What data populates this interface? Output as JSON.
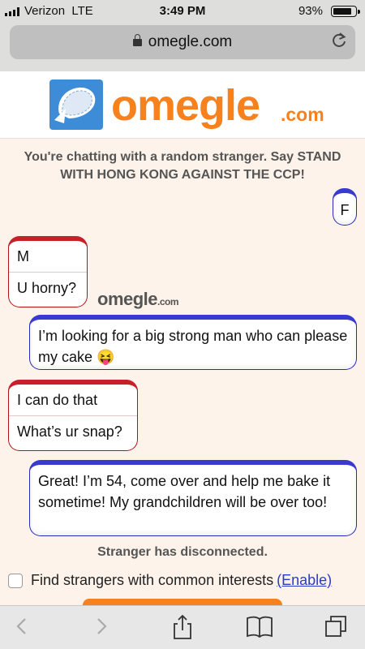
{
  "status_bar": {
    "carrier": "Verizon",
    "network": "LTE",
    "time": "3:49 PM",
    "battery_percent_text": "93%",
    "battery_level": 0.93
  },
  "browser": {
    "url": "omegle.com",
    "icons": [
      "lock-icon",
      "reload-icon",
      "back-icon",
      "forward-icon",
      "share-icon",
      "bookmarks-icon",
      "tabs-icon"
    ]
  },
  "site": {
    "logo_word": "omegle",
    "logo_tld": ".com",
    "brand_color": "#f7811d",
    "watermark_word": "omegle",
    "watermark_tld": ".com"
  },
  "chat": {
    "intro": "You're chatting with a random stranger. Say STAND WITH HONG KONG AGAINST THE CCP!",
    "messages": [
      {
        "from": "you",
        "lines": [
          "F"
        ]
      },
      {
        "from": "stranger",
        "lines": [
          "M",
          "U horny?"
        ]
      },
      {
        "from": "you",
        "lines": [
          "I’m looking for a big strong man who can please my cake 😝"
        ]
      },
      {
        "from": "stranger",
        "lines": [
          "I can do that",
          "What’s ur snap?"
        ]
      },
      {
        "from": "you",
        "lines": [
          "Great! I’m 54, come over and help me bake it sometime! My grandchildren will be over too!"
        ]
      }
    ],
    "disconnected": "Stranger has disconnected.",
    "interests_label": "Find strangers with common interests",
    "interests_link": "(Enable)"
  },
  "colors": {
    "you_border": "#2b2ab8",
    "stranger_border": "#b0141a",
    "background": "#fdf3ea"
  }
}
